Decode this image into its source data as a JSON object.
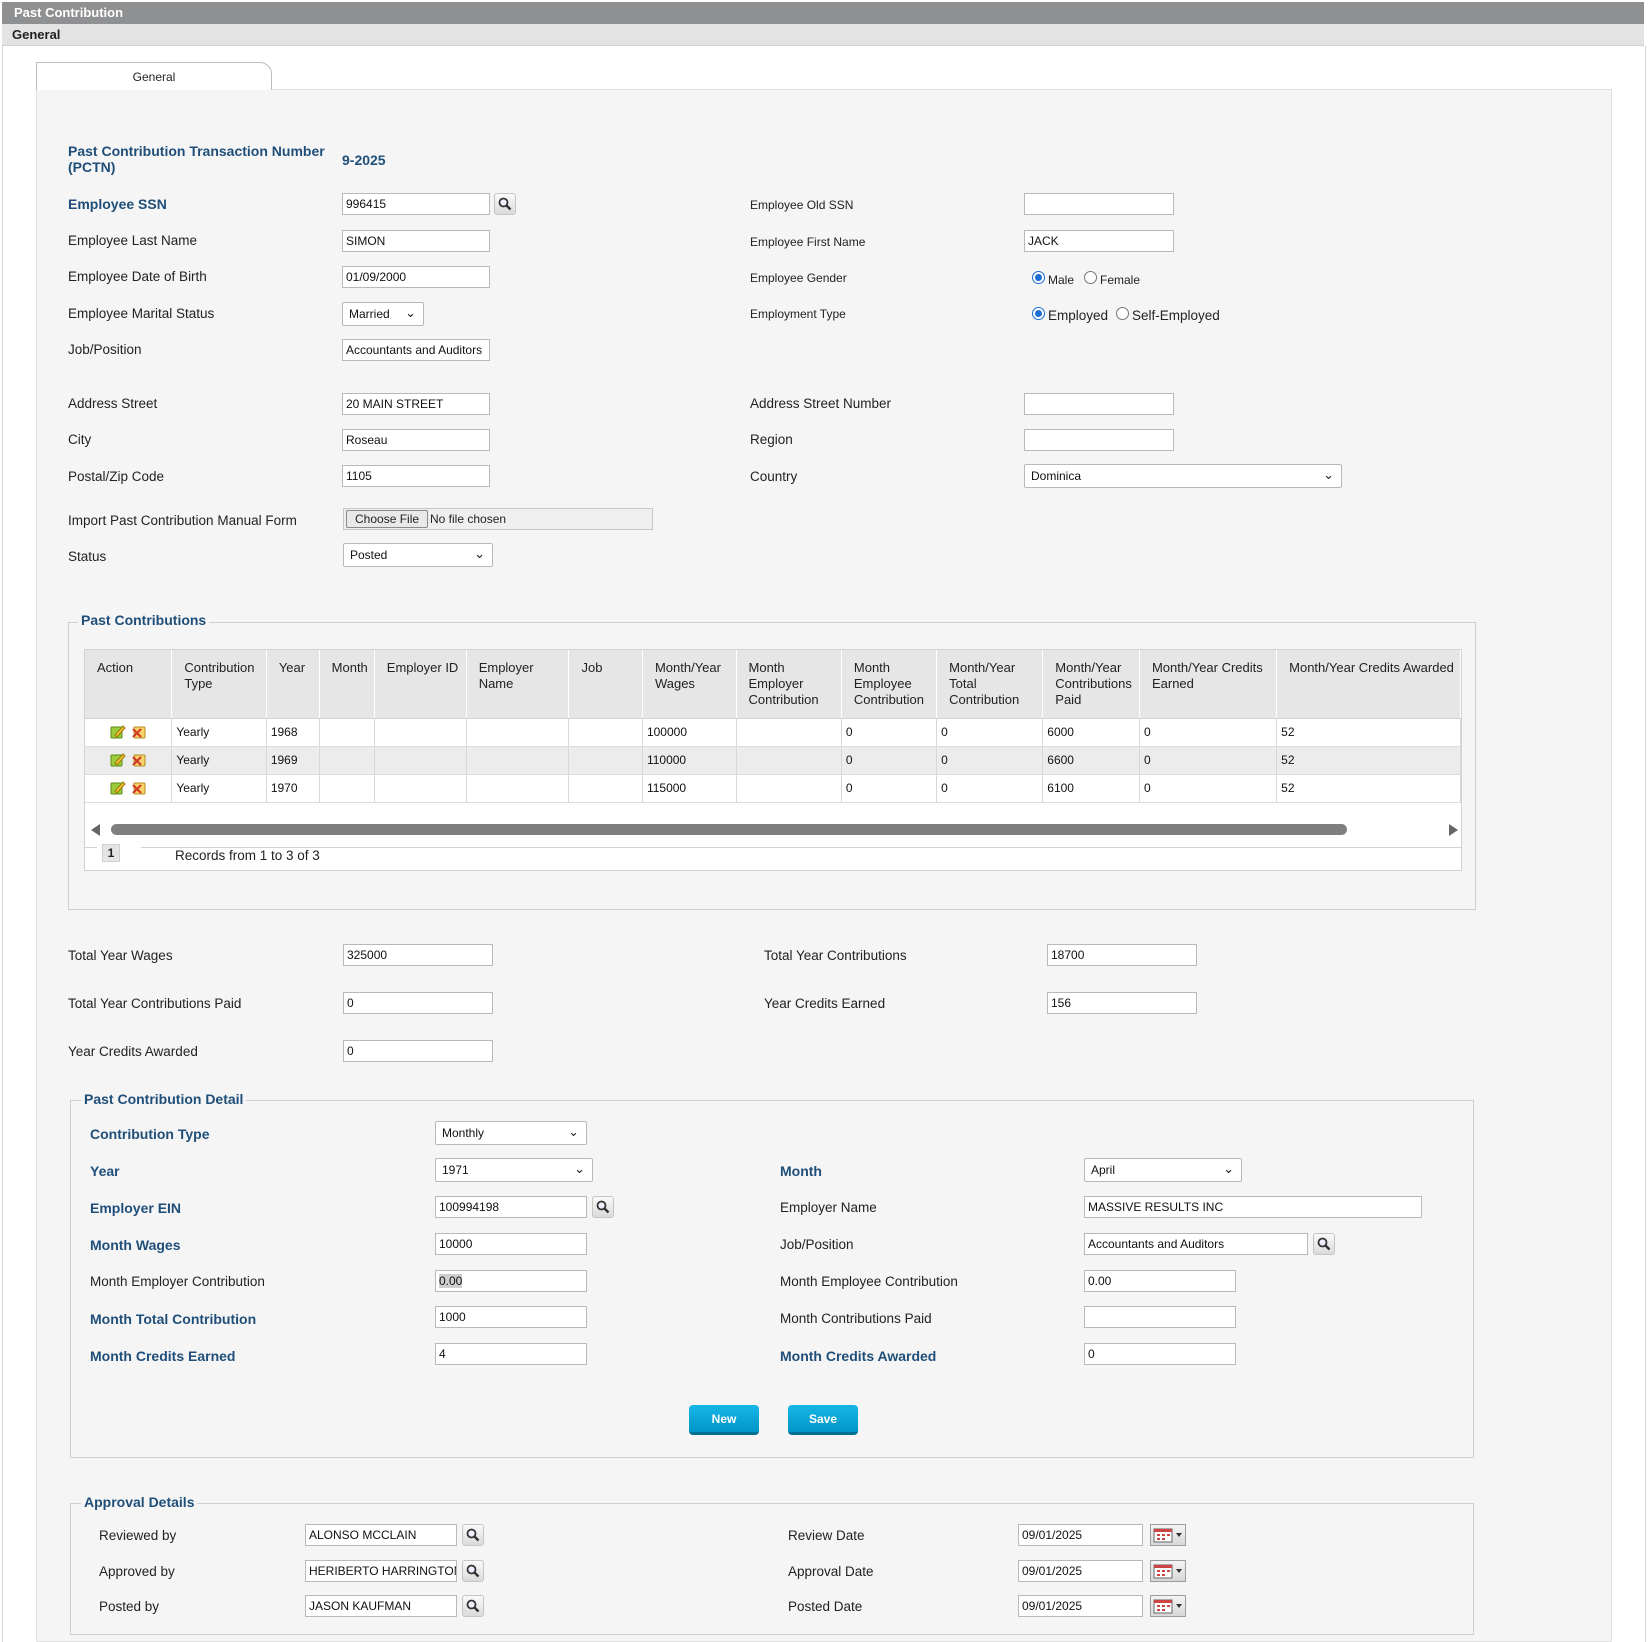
{
  "window": {
    "title": "Past Contribution",
    "subtitle": "General"
  },
  "tabs": [
    {
      "label": "General"
    }
  ],
  "header": {
    "pctn_label": "Past Contribution Transaction Number (PCTN)",
    "pctn_value": "9-2025"
  },
  "employee": {
    "ssn_label": "Employee SSN",
    "ssn": "996415",
    "old_ssn_label": "Employee Old SSN",
    "old_ssn": "",
    "last_name_label": "Employee Last Name",
    "last_name": "SIMON",
    "first_name_label": "Employee First Name",
    "first_name": "JACK",
    "dob_label": "Employee Date of Birth",
    "dob": "01/09/2000",
    "gender_label": "Employee Gender",
    "gender_male": "Male",
    "gender_female": "Female",
    "gender_selected": "Male",
    "marital_label": "Employee Marital Status",
    "marital": "Married",
    "employment_type_label": "Employment Type",
    "emp_employed": "Employed",
    "emp_self": "Self-Employed",
    "employment_selected": "Employed",
    "job_label": "Job/Position",
    "job": "Accountants and Auditors"
  },
  "address": {
    "street_label": "Address Street",
    "street": "20 MAIN STREET",
    "street_number_label": "Address Street Number",
    "street_number": "",
    "city_label": "City",
    "city": "Roseau",
    "region_label": "Region",
    "region": "",
    "postal_label": "Postal/Zip Code",
    "postal": "1105",
    "country_label": "Country",
    "country": "Dominica"
  },
  "import": {
    "label": "Import Past Contribution Manual Form",
    "button": "Choose File",
    "file_status": "No file chosen"
  },
  "status": {
    "label": "Status",
    "value": "Posted"
  },
  "past_contributions": {
    "legend": "Past Contributions",
    "columns": [
      "Action",
      "Contribution Type",
      "Year",
      "Month",
      "Employer ID",
      "Employer Name",
      "Job",
      "Month/Year Wages",
      "Month Employer Contribution",
      "Month Employee Contribution",
      "Month/Year Total Contribution",
      "Month/Year Contributions Paid",
      "Month/Year Credits Earned",
      "Month/Year Credits Awarded"
    ],
    "rows": [
      [
        "",
        "Yearly",
        "1968",
        "",
        "",
        "",
        "",
        "100000",
        "",
        "0",
        "0",
        "6000",
        "0",
        "52"
      ],
      [
        "",
        "Yearly",
        "1969",
        "",
        "",
        "",
        "",
        "110000",
        "",
        "0",
        "0",
        "6600",
        "0",
        "52"
      ],
      [
        "",
        "Yearly",
        "1970",
        "",
        "",
        "",
        "",
        "115000",
        "",
        "0",
        "0",
        "6100",
        "0",
        "52"
      ]
    ],
    "page": "1",
    "records_text": "Records from 1 to 3 of 3"
  },
  "totals": {
    "wages_label": "Total Year Wages",
    "wages": "325000",
    "contributions_label": "Total Year Contributions",
    "contributions": "18700",
    "paid_label": "Total Year Contributions Paid",
    "paid": "0",
    "credits_earned_label": "Year Credits Earned",
    "credits_earned": "156",
    "credits_awarded_label": "Year Credits Awarded",
    "credits_awarded": "0"
  },
  "detail": {
    "legend": "Past Contribution Detail",
    "type_label": "Contribution Type",
    "type": "Monthly",
    "year_label": "Year",
    "year": "1971",
    "month_label": "Month",
    "month": "April",
    "ein_label": "Employer EIN",
    "ein": "100994198",
    "employer_name_label": "Employer Name",
    "employer_name": "MASSIVE RESULTS INC",
    "wages_label": "Month Wages",
    "wages": "10000",
    "job_label": "Job/Position",
    "job": "Accountants and Auditors",
    "employer_contrib_label": "Month Employer Contribution",
    "employer_contrib": "0.00",
    "employee_contrib_label": "Month Employee Contribution",
    "employee_contrib": "0.00",
    "total_contrib_label": "Month Total Contribution",
    "total_contrib": "1000",
    "contrib_paid_label": "Month Contributions Paid",
    "contrib_paid": "",
    "credits_earned_label": "Month Credits Earned",
    "credits_earned": "4",
    "credits_awarded_label": "Month Credits Awarded",
    "credits_awarded": "0",
    "new_button": "New",
    "save_button": "Save"
  },
  "approval": {
    "legend": "Approval Details",
    "reviewed_by_label": "Reviewed by",
    "reviewed_by": "ALONSO MCCLAIN",
    "review_date_label": "Review Date",
    "review_date": "09/01/2025",
    "approved_by_label": "Approved by",
    "approved_by": "HERIBERTO HARRINGTON",
    "approval_date_label": "Approval Date",
    "approval_date": "09/01/2025",
    "posted_by_label": "Posted by",
    "posted_by": "JASON KAUFMAN",
    "posted_date_label": "Posted Date",
    "posted_date": "09/01/2025"
  },
  "icons": {
    "search": "magnifier-icon",
    "calendar": "calendar-icon",
    "edit": "edit-icon",
    "delete": "delete-icon",
    "dropdown": "chevron-down-icon"
  },
  "colors": {
    "label_accent": "#1f4e79",
    "button": "#0aa7da",
    "title_bar": "#8f9092"
  }
}
